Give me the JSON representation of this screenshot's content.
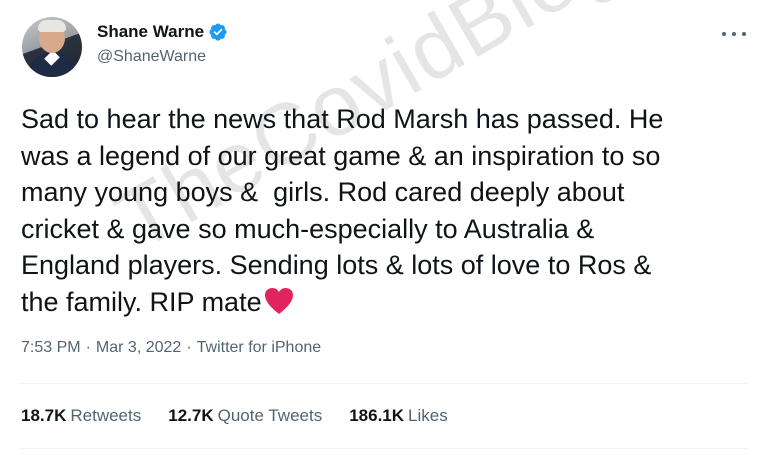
{
  "author": {
    "display_name": "Shane Warne",
    "handle": "@ShaneWarne",
    "verified": true
  },
  "tweet": {
    "text": "Sad to hear the news that Rod Marsh has passed. He\nwas a legend of our great game & an inspiration to so\nmany young boys &  girls. Rod cared deeply about\ncricket & gave so much-especially to Australia &\nEngland players. Sending lots & lots of love to Ros &\nthe family. RIP mate",
    "emoji": "red-heart-icon"
  },
  "meta": {
    "time": "7:53 PM",
    "separator": "·",
    "date": "Mar 3, 2022",
    "source": "Twitter for iPhone"
  },
  "stats": {
    "retweets_count": "18.7K",
    "retweets_label": "Retweets",
    "quotes_count": "12.7K",
    "quotes_label": "Quote Tweets",
    "likes_count": "186.1K",
    "likes_label": "Likes"
  },
  "watermark": "TheCovidBlog.com",
  "colors": {
    "verified_blue": "#1d9bf0",
    "secondary_text": "#536471",
    "heart_red": "#e0245e"
  }
}
